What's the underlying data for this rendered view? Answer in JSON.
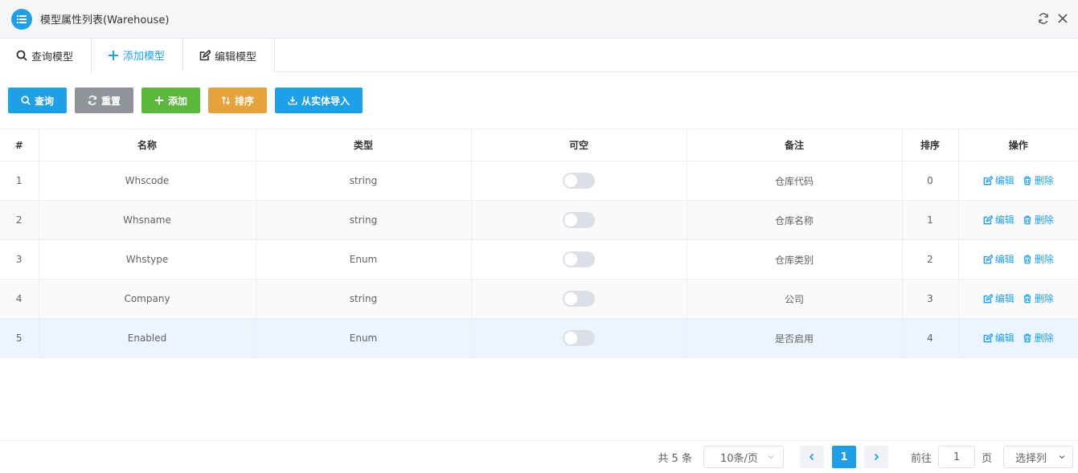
{
  "window": {
    "title": "模型属性列表(Warehouse)"
  },
  "tabs": [
    {
      "label": "查询模型",
      "icon": "search-icon"
    },
    {
      "label": "添加模型",
      "icon": "plus-icon",
      "active": true
    },
    {
      "label": "编辑模型",
      "icon": "edit-icon"
    }
  ],
  "toolbar": {
    "query": "查询",
    "reset": "重置",
    "add": "添加",
    "sort": "排序",
    "import": "从实体导入"
  },
  "table": {
    "headers": [
      "#",
      "名称",
      "类型",
      "可空",
      "备注",
      "排序",
      "操作"
    ],
    "rows": [
      {
        "idx": "1",
        "name": "Whscode",
        "type": "string",
        "nullable": false,
        "remark": "仓库代码",
        "order": "0"
      },
      {
        "idx": "2",
        "name": "Whsname",
        "type": "string",
        "nullable": false,
        "remark": "仓库名称",
        "order": "1"
      },
      {
        "idx": "3",
        "name": "Whstype",
        "type": "Enum",
        "nullable": false,
        "remark": "仓库类别",
        "order": "2"
      },
      {
        "idx": "4",
        "name": "Company",
        "type": "string",
        "nullable": false,
        "remark": "公司",
        "order": "3"
      },
      {
        "idx": "5",
        "name": "Enabled",
        "type": "Enum",
        "nullable": false,
        "remark": "是否启用",
        "order": "4"
      }
    ],
    "edit_label": "编辑",
    "delete_label": "删除"
  },
  "pagination": {
    "total": "共 5 条",
    "page_size": "10条/页",
    "current_page": "1",
    "goto_prefix": "前往",
    "goto_value": "1",
    "goto_suffix": "页",
    "columns": "选择列"
  },
  "colors": {
    "primary": "#1e9fe6",
    "success": "#5cb83a",
    "warning": "#e6a23c",
    "info": "#909399"
  }
}
